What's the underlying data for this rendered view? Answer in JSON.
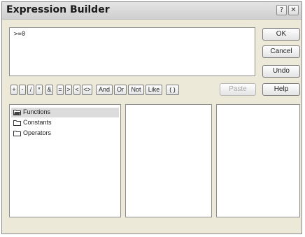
{
  "window": {
    "title": "Expression Builder",
    "help_glyph": "?",
    "close_glyph": "✕"
  },
  "expression": {
    "value": ">=0"
  },
  "side_buttons": {
    "ok": "OK",
    "cancel": "Cancel",
    "undo": "Undo",
    "help": "Help"
  },
  "operators": [
    "+",
    "-",
    "/",
    "*",
    "&",
    "=",
    ">",
    "<",
    "<>",
    "And",
    "Or",
    "Not",
    "Like",
    "( )"
  ],
  "paste_label": "Paste",
  "tree": {
    "items": [
      {
        "label": "Functions",
        "icon": "folder-expanded-icon",
        "selected": true
      },
      {
        "label": "Constants",
        "icon": "folder-icon",
        "selected": false
      },
      {
        "label": "Operators",
        "icon": "folder-icon",
        "selected": false
      }
    ]
  },
  "colors": {
    "window_bg": "#ece9d8",
    "selection": "#dcdcdc"
  }
}
